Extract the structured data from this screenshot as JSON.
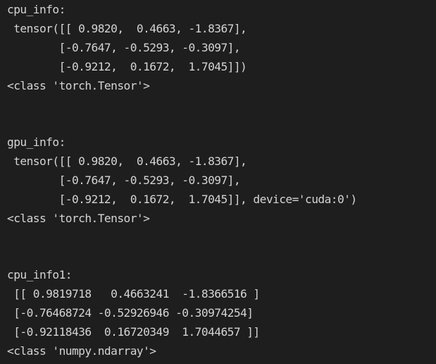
{
  "console": {
    "lines": [
      "cpu_info:",
      " tensor([[ 0.9820,  0.4663, -1.8367],",
      "        [-0.7647, -0.5293, -0.3097],",
      "        [-0.9212,  0.1672,  1.7045]])",
      "<class 'torch.Tensor'>",
      "",
      "",
      "gpu_info:",
      " tensor([[ 0.9820,  0.4663, -1.8367],",
      "        [-0.7647, -0.5293, -0.3097],",
      "        [-0.9212,  0.1672,  1.7045]], device='cuda:0')",
      "<class 'torch.Tensor'>",
      "",
      "",
      "cpu_info1:",
      " [[ 0.9819718   0.4663241  -1.8366516 ]",
      " [-0.76468724 -0.52926946 -0.30974254]",
      " [-0.92118436  0.16720349  1.7044657 ]]",
      "<class 'numpy.ndarray'>"
    ]
  }
}
